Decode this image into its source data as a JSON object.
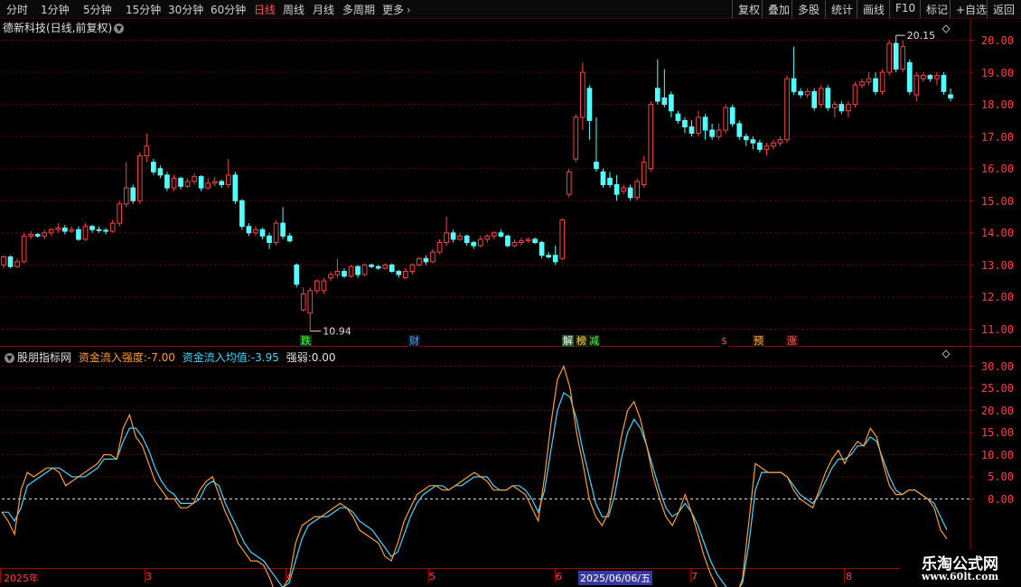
{
  "toolbar": {
    "periods": [
      "分时",
      "1分钟",
      "5分钟",
      "15分钟",
      "30分钟",
      "60分钟",
      "日线",
      "周线",
      "月线",
      "多周期",
      "更多"
    ],
    "active_period": "日线",
    "right_buttons": [
      "复权",
      "叠加",
      "多股",
      "统计",
      "画线",
      "F10",
      "标记",
      "+自选",
      "返回"
    ]
  },
  "main_panel": {
    "title": "德新科技(日线,前复权)",
    "high_label": "20.15",
    "low_label": "10.94",
    "price_axis": [
      "20.00",
      "19.00",
      "18.00",
      "17.00",
      "16.00",
      "15.00",
      "14.00",
      "13.00",
      "12.00",
      "11.00"
    ],
    "event_marks": [
      {
        "label": "跌",
        "color": "#40ff40",
        "bg": "#1a3a1a"
      },
      {
        "label": "财",
        "color": "#40a0ff",
        "bg": "#101a2a"
      },
      {
        "label": "解",
        "color": "#ffffff",
        "bg": "#2a5a2a"
      },
      {
        "label": "榜",
        "color": "#ffd040",
        "bg": "#2a2a10"
      },
      {
        "label": "减",
        "color": "#40ff40",
        "bg": "#10200a"
      },
      {
        "label": "$",
        "color": "#ff4040",
        "bg": "#000000"
      },
      {
        "label": "预",
        "color": "#ffb040",
        "bg": "#301a00"
      },
      {
        "label": "涨",
        "color": "#ff6060",
        "bg": "#3a0a0a"
      }
    ]
  },
  "indicator_panel": {
    "name": "股朋指标网",
    "strength_label": "资金流入强度:",
    "strength_value": "-7.00",
    "avg_label": "资金流入均值:",
    "avg_value": "-3.95",
    "weak_label": "强弱:",
    "weak_value": "0.00",
    "axis": [
      "30.00",
      "25.00",
      "20.00",
      "15.00",
      "10.00",
      "5.00",
      "0.00"
    ]
  },
  "date_axis": {
    "labels": [
      "2025年",
      "3",
      "4",
      "5",
      "6",
      "2025/06/06/五",
      "7",
      "8"
    ],
    "highlighted": "2025/06/06/五"
  },
  "colors": {
    "up": "#ff4040",
    "down": "#54ffff",
    "grid": "#6a0000",
    "strength_line": "#ff9a30",
    "avg_line": "#40d8ff"
  },
  "chart_data": {
    "type": "candlestick",
    "ylim": [
      10.7,
      20.4
    ],
    "candles": [
      {
        "o": 13.0,
        "c": 13.25,
        "h": 13.3,
        "l": 12.9
      },
      {
        "o": 13.25,
        "c": 12.95,
        "h": 13.3,
        "l": 12.9
      },
      {
        "o": 12.95,
        "c": 13.1,
        "h": 13.2,
        "l": 12.9
      },
      {
        "o": 13.1,
        "c": 13.9,
        "h": 14.0,
        "l": 13.05
      },
      {
        "o": 13.9,
        "c": 13.95,
        "h": 14.05,
        "l": 13.8
      },
      {
        "o": 13.95,
        "c": 13.9,
        "h": 14.0,
        "l": 13.85
      },
      {
        "o": 13.9,
        "c": 14.0,
        "h": 14.1,
        "l": 13.8
      },
      {
        "o": 14.0,
        "c": 14.1,
        "h": 14.15,
        "l": 13.9
      },
      {
        "o": 14.1,
        "c": 14.15,
        "h": 14.3,
        "l": 14.0
      },
      {
        "o": 14.15,
        "c": 14.05,
        "h": 14.25,
        "l": 13.95
      },
      {
        "o": 14.05,
        "c": 14.1,
        "h": 14.2,
        "l": 14.0
      },
      {
        "o": 14.1,
        "c": 13.8,
        "h": 14.2,
        "l": 13.75
      },
      {
        "o": 13.8,
        "c": 14.2,
        "h": 14.3,
        "l": 13.75
      },
      {
        "o": 14.2,
        "c": 14.1,
        "h": 14.25,
        "l": 14.0
      },
      {
        "o": 14.1,
        "c": 14.08,
        "h": 14.2,
        "l": 14.0
      },
      {
        "o": 14.08,
        "c": 14.05,
        "h": 14.15,
        "l": 13.95
      },
      {
        "o": 14.05,
        "c": 14.3,
        "h": 14.4,
        "l": 14.0
      },
      {
        "o": 14.3,
        "c": 14.9,
        "h": 15.0,
        "l": 14.2
      },
      {
        "o": 14.9,
        "c": 15.4,
        "h": 16.2,
        "l": 14.8
      },
      {
        "o": 15.4,
        "c": 15.0,
        "h": 15.5,
        "l": 14.9
      },
      {
        "o": 15.0,
        "c": 16.4,
        "h": 16.5,
        "l": 14.9
      },
      {
        "o": 16.4,
        "c": 16.7,
        "h": 17.1,
        "l": 16.2
      },
      {
        "o": 16.2,
        "c": 15.9,
        "h": 16.3,
        "l": 15.8
      },
      {
        "o": 16.0,
        "c": 15.8,
        "h": 16.1,
        "l": 15.7
      },
      {
        "o": 15.8,
        "c": 15.4,
        "h": 15.9,
        "l": 15.3
      },
      {
        "o": 15.4,
        "c": 15.7,
        "h": 15.8,
        "l": 15.3
      },
      {
        "o": 15.7,
        "c": 15.45,
        "h": 15.75,
        "l": 15.35
      },
      {
        "o": 15.45,
        "c": 15.6,
        "h": 15.7,
        "l": 15.4
      },
      {
        "o": 15.6,
        "c": 15.75,
        "h": 15.85,
        "l": 15.5
      },
      {
        "o": 15.75,
        "c": 15.4,
        "h": 15.8,
        "l": 15.3
      },
      {
        "o": 15.4,
        "c": 15.55,
        "h": 15.7,
        "l": 15.35
      },
      {
        "o": 15.55,
        "c": 15.6,
        "h": 15.75,
        "l": 15.45
      },
      {
        "o": 15.6,
        "c": 15.5,
        "h": 15.65,
        "l": 15.4
      },
      {
        "o": 15.5,
        "c": 15.8,
        "h": 16.3,
        "l": 15.4
      },
      {
        "o": 15.8,
        "c": 15.0,
        "h": 15.9,
        "l": 14.9
      },
      {
        "o": 15.0,
        "c": 14.2,
        "h": 15.05,
        "l": 14.1
      },
      {
        "o": 14.2,
        "c": 14.0,
        "h": 14.3,
        "l": 13.9
      },
      {
        "o": 14.0,
        "c": 14.1,
        "h": 14.2,
        "l": 13.9
      },
      {
        "o": 14.1,
        "c": 13.9,
        "h": 14.15,
        "l": 13.8
      },
      {
        "o": 13.9,
        "c": 13.7,
        "h": 14.0,
        "l": 13.5
      },
      {
        "o": 13.7,
        "c": 14.3,
        "h": 14.4,
        "l": 13.6
      },
      {
        "o": 14.3,
        "c": 13.9,
        "h": 14.8,
        "l": 13.8
      },
      {
        "o": 13.9,
        "c": 13.75,
        "h": 14.0,
        "l": 13.7
      },
      {
        "o": 13.0,
        "c": 12.4,
        "h": 13.05,
        "l": 12.3
      },
      {
        "o": 11.6,
        "c": 12.1,
        "h": 12.3,
        "l": 11.55
      },
      {
        "o": 11.5,
        "c": 12.2,
        "h": 12.3,
        "l": 10.94
      },
      {
        "o": 12.2,
        "c": 12.5,
        "h": 12.55,
        "l": 12.1
      },
      {
        "o": 12.2,
        "c": 12.5,
        "h": 12.6,
        "l": 12.1
      },
      {
        "o": 12.6,
        "c": 12.7,
        "h": 12.8,
        "l": 12.5
      },
      {
        "o": 12.7,
        "c": 12.8,
        "h": 13.2,
        "l": 12.6
      },
      {
        "o": 12.8,
        "c": 12.65,
        "h": 12.9,
        "l": 12.6
      },
      {
        "o": 12.65,
        "c": 12.95,
        "h": 13.0,
        "l": 12.6
      },
      {
        "o": 12.95,
        "c": 12.7,
        "h": 13.0,
        "l": 12.6
      },
      {
        "o": 12.7,
        "c": 13.0,
        "h": 13.05,
        "l": 12.65
      },
      {
        "o": 13.0,
        "c": 12.95,
        "h": 13.05,
        "l": 12.9
      },
      {
        "o": 12.95,
        "c": 12.9,
        "h": 13.0,
        "l": 12.85
      },
      {
        "o": 12.9,
        "c": 13.0,
        "h": 13.05,
        "l": 12.85
      },
      {
        "o": 13.0,
        "c": 12.8,
        "h": 13.05,
        "l": 12.75
      },
      {
        "o": 12.8,
        "c": 12.7,
        "h": 12.85,
        "l": 12.6
      },
      {
        "o": 12.6,
        "c": 12.8,
        "h": 12.9,
        "l": 12.55
      },
      {
        "o": 12.8,
        "c": 13.0,
        "h": 13.05,
        "l": 12.7
      },
      {
        "o": 13.0,
        "c": 13.2,
        "h": 13.25,
        "l": 12.95
      },
      {
        "o": 13.2,
        "c": 13.1,
        "h": 13.3,
        "l": 13.0
      },
      {
        "o": 13.1,
        "c": 13.4,
        "h": 13.5,
        "l": 13.05
      },
      {
        "o": 13.4,
        "c": 13.7,
        "h": 13.8,
        "l": 13.35
      },
      {
        "o": 13.7,
        "c": 14.0,
        "h": 14.5,
        "l": 13.6
      },
      {
        "o": 14.0,
        "c": 13.8,
        "h": 14.1,
        "l": 13.7
      },
      {
        "o": 13.8,
        "c": 13.9,
        "h": 14.0,
        "l": 13.75
      },
      {
        "o": 13.9,
        "c": 13.7,
        "h": 13.95,
        "l": 13.6
      },
      {
        "o": 13.7,
        "c": 13.6,
        "h": 13.75,
        "l": 13.5
      },
      {
        "o": 13.6,
        "c": 13.8,
        "h": 13.9,
        "l": 13.55
      },
      {
        "o": 13.8,
        "c": 13.9,
        "h": 13.95,
        "l": 13.7
      },
      {
        "o": 13.9,
        "c": 14.0,
        "h": 14.05,
        "l": 13.8
      },
      {
        "o": 14.0,
        "c": 13.9,
        "h": 14.1,
        "l": 13.85
      },
      {
        "o": 13.9,
        "c": 13.6,
        "h": 13.95,
        "l": 13.55
      },
      {
        "o": 13.6,
        "c": 13.7,
        "h": 13.8,
        "l": 13.55
      },
      {
        "o": 13.7,
        "c": 13.75,
        "h": 13.85,
        "l": 13.6
      },
      {
        "o": 13.75,
        "c": 13.8,
        "h": 13.85,
        "l": 13.7
      },
      {
        "o": 13.8,
        "c": 13.7,
        "h": 13.85,
        "l": 13.65
      },
      {
        "o": 13.7,
        "c": 13.3,
        "h": 13.75,
        "l": 13.2
      },
      {
        "o": 13.3,
        "c": 13.25,
        "h": 13.4,
        "l": 13.2
      },
      {
        "o": 13.3,
        "c": 13.1,
        "h": 13.6,
        "l": 13.0
      },
      {
        "o": 13.2,
        "c": 14.4,
        "h": 14.45,
        "l": 13.15
      },
      {
        "o": 15.2,
        "c": 15.9,
        "h": 16.0,
        "l": 15.1
      },
      {
        "o": 16.3,
        "c": 17.6,
        "h": 17.7,
        "l": 16.2
      },
      {
        "o": 17.6,
        "c": 19.0,
        "h": 19.3,
        "l": 17.2
      },
      {
        "o": 18.5,
        "c": 17.5,
        "h": 18.6,
        "l": 16.9
      },
      {
        "o": 16.2,
        "c": 16.0,
        "h": 17.6,
        "l": 15.9
      },
      {
        "o": 15.9,
        "c": 15.5,
        "h": 16.0,
        "l": 15.4
      },
      {
        "o": 15.7,
        "c": 15.5,
        "h": 15.9,
        "l": 15.4
      },
      {
        "o": 15.5,
        "c": 15.2,
        "h": 15.8,
        "l": 15.0
      },
      {
        "o": 15.3,
        "c": 15.4,
        "h": 15.5,
        "l": 15.2
      },
      {
        "o": 15.4,
        "c": 15.1,
        "h": 15.5,
        "l": 15.0
      },
      {
        "o": 15.1,
        "c": 15.6,
        "h": 15.7,
        "l": 15.0
      },
      {
        "o": 15.5,
        "c": 16.2,
        "h": 16.4,
        "l": 15.4
      },
      {
        "o": 16.0,
        "c": 18.0,
        "h": 18.1,
        "l": 15.9
      },
      {
        "o": 18.5,
        "c": 18.1,
        "h": 19.4,
        "l": 18.0
      },
      {
        "o": 18.2,
        "c": 18.0,
        "h": 19.1,
        "l": 17.9
      },
      {
        "o": 18.3,
        "c": 17.8,
        "h": 18.4,
        "l": 17.6
      },
      {
        "o": 17.7,
        "c": 17.5,
        "h": 17.8,
        "l": 17.4
      },
      {
        "o": 17.5,
        "c": 17.3,
        "h": 17.6,
        "l": 17.1
      },
      {
        "o": 17.3,
        "c": 17.1,
        "h": 17.5,
        "l": 17.0
      },
      {
        "o": 17.1,
        "c": 17.6,
        "h": 17.8,
        "l": 17.0
      },
      {
        "o": 17.6,
        "c": 17.2,
        "h": 17.7,
        "l": 16.9
      },
      {
        "o": 17.2,
        "c": 17.0,
        "h": 17.4,
        "l": 16.9
      },
      {
        "o": 17.0,
        "c": 17.2,
        "h": 17.4,
        "l": 16.9
      },
      {
        "o": 17.2,
        "c": 17.9,
        "h": 18.0,
        "l": 17.1
      },
      {
        "o": 17.9,
        "c": 17.4,
        "h": 18.0,
        "l": 17.3
      },
      {
        "o": 17.4,
        "c": 17.0,
        "h": 17.5,
        "l": 16.9
      },
      {
        "o": 17.0,
        "c": 16.9,
        "h": 17.1,
        "l": 16.7
      },
      {
        "o": 16.9,
        "c": 16.8,
        "h": 17.0,
        "l": 16.6
      },
      {
        "o": 16.8,
        "c": 16.6,
        "h": 16.9,
        "l": 16.5
      },
      {
        "o": 16.6,
        "c": 16.7,
        "h": 16.8,
        "l": 16.4
      },
      {
        "o": 16.7,
        "c": 16.8,
        "h": 16.9,
        "l": 16.6
      },
      {
        "o": 16.8,
        "c": 16.9,
        "h": 17.0,
        "l": 16.7
      },
      {
        "o": 16.9,
        "c": 18.8,
        "h": 18.9,
        "l": 16.8
      },
      {
        "o": 18.8,
        "c": 18.4,
        "h": 19.8,
        "l": 18.3
      },
      {
        "o": 18.4,
        "c": 18.3,
        "h": 18.5,
        "l": 18.2
      },
      {
        "o": 18.3,
        "c": 18.4,
        "h": 18.5,
        "l": 18.2
      },
      {
        "o": 18.4,
        "c": 17.9,
        "h": 18.5,
        "l": 17.8
      },
      {
        "o": 18.0,
        "c": 18.5,
        "h": 18.6,
        "l": 17.9
      },
      {
        "o": 18.5,
        "c": 17.9,
        "h": 18.6,
        "l": 17.8
      },
      {
        "o": 17.9,
        "c": 18.0,
        "h": 18.1,
        "l": 17.6
      },
      {
        "o": 18.0,
        "c": 17.8,
        "h": 18.1,
        "l": 17.7
      },
      {
        "o": 17.8,
        "c": 18.0,
        "h": 18.1,
        "l": 17.6
      },
      {
        "o": 18.0,
        "c": 18.6,
        "h": 18.7,
        "l": 17.9
      },
      {
        "o": 18.6,
        "c": 18.7,
        "h": 18.8,
        "l": 18.5
      },
      {
        "o": 18.7,
        "c": 18.8,
        "h": 19.0,
        "l": 18.6
      },
      {
        "o": 18.8,
        "c": 18.4,
        "h": 19.0,
        "l": 18.3
      },
      {
        "o": 18.4,
        "c": 19.0,
        "h": 19.1,
        "l": 18.3
      },
      {
        "o": 19.0,
        "c": 19.9,
        "h": 20.0,
        "l": 18.9
      },
      {
        "o": 19.9,
        "c": 19.1,
        "h": 20.15,
        "l": 19.0
      },
      {
        "o": 19.1,
        "c": 19.8,
        "h": 20.0,
        "l": 19.0
      },
      {
        "o": 19.3,
        "c": 18.4,
        "h": 19.4,
        "l": 18.3
      },
      {
        "o": 18.3,
        "c": 18.9,
        "h": 19.0,
        "l": 18.1
      },
      {
        "o": 18.8,
        "c": 18.9,
        "h": 19.0,
        "l": 18.7
      },
      {
        "o": 18.9,
        "c": 18.8,
        "h": 18.95,
        "l": 18.7
      },
      {
        "o": 18.8,
        "c": 18.9,
        "h": 19.0,
        "l": 18.6
      },
      {
        "o": 18.9,
        "c": 18.4,
        "h": 19.0,
        "l": 18.3
      },
      {
        "o": 18.3,
        "c": 18.2,
        "h": 18.5,
        "l": 18.1
      }
    ],
    "indicator": {
      "ylim": [
        -15,
        32
      ],
      "strength": [
        -3,
        -5,
        -8,
        2,
        6,
        5,
        6,
        7,
        7,
        6,
        3,
        4,
        5,
        6,
        7,
        8,
        10,
        10,
        9,
        16,
        19,
        14,
        12,
        8,
        4,
        2,
        0,
        0,
        -2,
        -2,
        -1,
        2,
        4,
        5,
        1,
        -3,
        -6,
        -10,
        -12,
        -14,
        -14,
        -15,
        -18,
        -22,
        -20,
        -18,
        -10,
        -6,
        -5,
        -4,
        -4,
        -3,
        -2,
        -1,
        -2,
        -4,
        -7,
        -8,
        -9,
        -10,
        -13,
        -14,
        -10,
        -5,
        -2,
        1,
        2,
        3,
        3,
        2,
        2,
        3,
        4,
        5,
        6,
        5,
        4,
        2,
        2,
        2,
        3,
        2,
        1,
        -2,
        -5,
        5,
        17,
        27,
        30,
        25,
        15,
        8,
        0,
        -4,
        -6,
        -3,
        5,
        14,
        20,
        22,
        18,
        12,
        5,
        0,
        -4,
        -6,
        -3,
        1,
        -3,
        -8,
        -13,
        -17,
        -20,
        -22,
        -23,
        -22,
        -18,
        -5,
        8,
        7,
        6,
        6,
        6,
        5,
        2,
        0,
        -1,
        -2,
        2,
        6,
        9,
        11,
        8,
        11,
        13,
        12,
        16,
        14,
        8,
        3,
        1,
        1,
        2,
        2,
        1,
        0,
        -2,
        -7,
        -9
      ],
      "average": [
        -3,
        -3,
        -5,
        -2,
        3,
        4,
        5,
        6,
        7,
        7,
        6,
        5,
        5,
        5,
        6,
        7,
        9,
        9,
        9,
        13,
        16,
        16,
        14,
        11,
        7,
        4,
        2,
        1,
        -1,
        -1,
        -1,
        0,
        3,
        4,
        3,
        -1,
        -4,
        -7,
        -10,
        -12,
        -13,
        -14,
        -16,
        -18,
        -20,
        -19,
        -14,
        -9,
        -6,
        -5,
        -4,
        -4,
        -3,
        -2,
        -2,
        -3,
        -5,
        -6,
        -7,
        -9,
        -11,
        -13,
        -12,
        -8,
        -4,
        -1,
        1,
        2,
        3,
        3,
        2,
        3,
        3,
        4,
        5,
        5,
        5,
        3,
        2,
        2,
        3,
        3,
        2,
        0,
        -3,
        2,
        11,
        20,
        24,
        23,
        18,
        11,
        5,
        -1,
        -4,
        -4,
        1,
        9,
        15,
        18,
        16,
        12,
        7,
        2,
        -2,
        -4,
        -3,
        -1,
        -3,
        -6,
        -10,
        -14,
        -17,
        -19,
        -21,
        -21,
        -19,
        -10,
        2,
        6,
        6,
        6,
        6,
        5,
        3,
        1,
        0,
        -1,
        1,
        4,
        7,
        9,
        9,
        10,
        12,
        12,
        14,
        13,
        9,
        5,
        2,
        1,
        2,
        2,
        1,
        0,
        -1,
        -4,
        -7
      ]
    }
  }
}
